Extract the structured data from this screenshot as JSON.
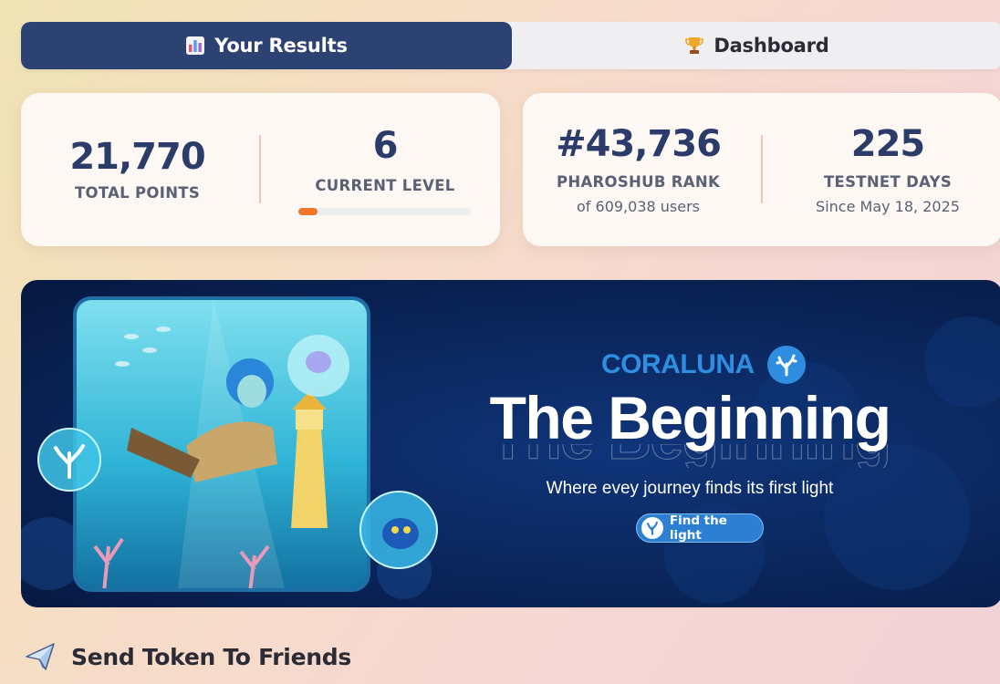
{
  "tabs": [
    {
      "label": "Your Results",
      "icon": "bar-chart-icon",
      "active": true
    },
    {
      "label": "Dashboard",
      "icon": "trophy-icon",
      "active": false
    }
  ],
  "stats": {
    "total_points": {
      "value": "21,770",
      "label": "TOTAL POINTS"
    },
    "current_level": {
      "value": "6",
      "label": "CURRENT LEVEL",
      "progress_percent": 11
    },
    "rank": {
      "value": "#43,736",
      "label": "PHAROSHUB RANK",
      "sub": "of 609,038 users"
    },
    "testnet_days": {
      "value": "225",
      "label": "TESTNET DAYS",
      "sub": "Since May 18, 2025"
    }
  },
  "banner": {
    "brand": "CORALUNA",
    "headline": "The Beginning",
    "tagline": "Where evey journey finds its first  light",
    "cta_label": "Find the light"
  },
  "section": {
    "title": "Send Token To Friends",
    "icon": "paper-plane-icon"
  },
  "colors": {
    "navy": "#2c4272",
    "accent_orange": "#f0762a",
    "brand_blue": "#2f8ee0",
    "stat_text": "#2b3c6b"
  }
}
